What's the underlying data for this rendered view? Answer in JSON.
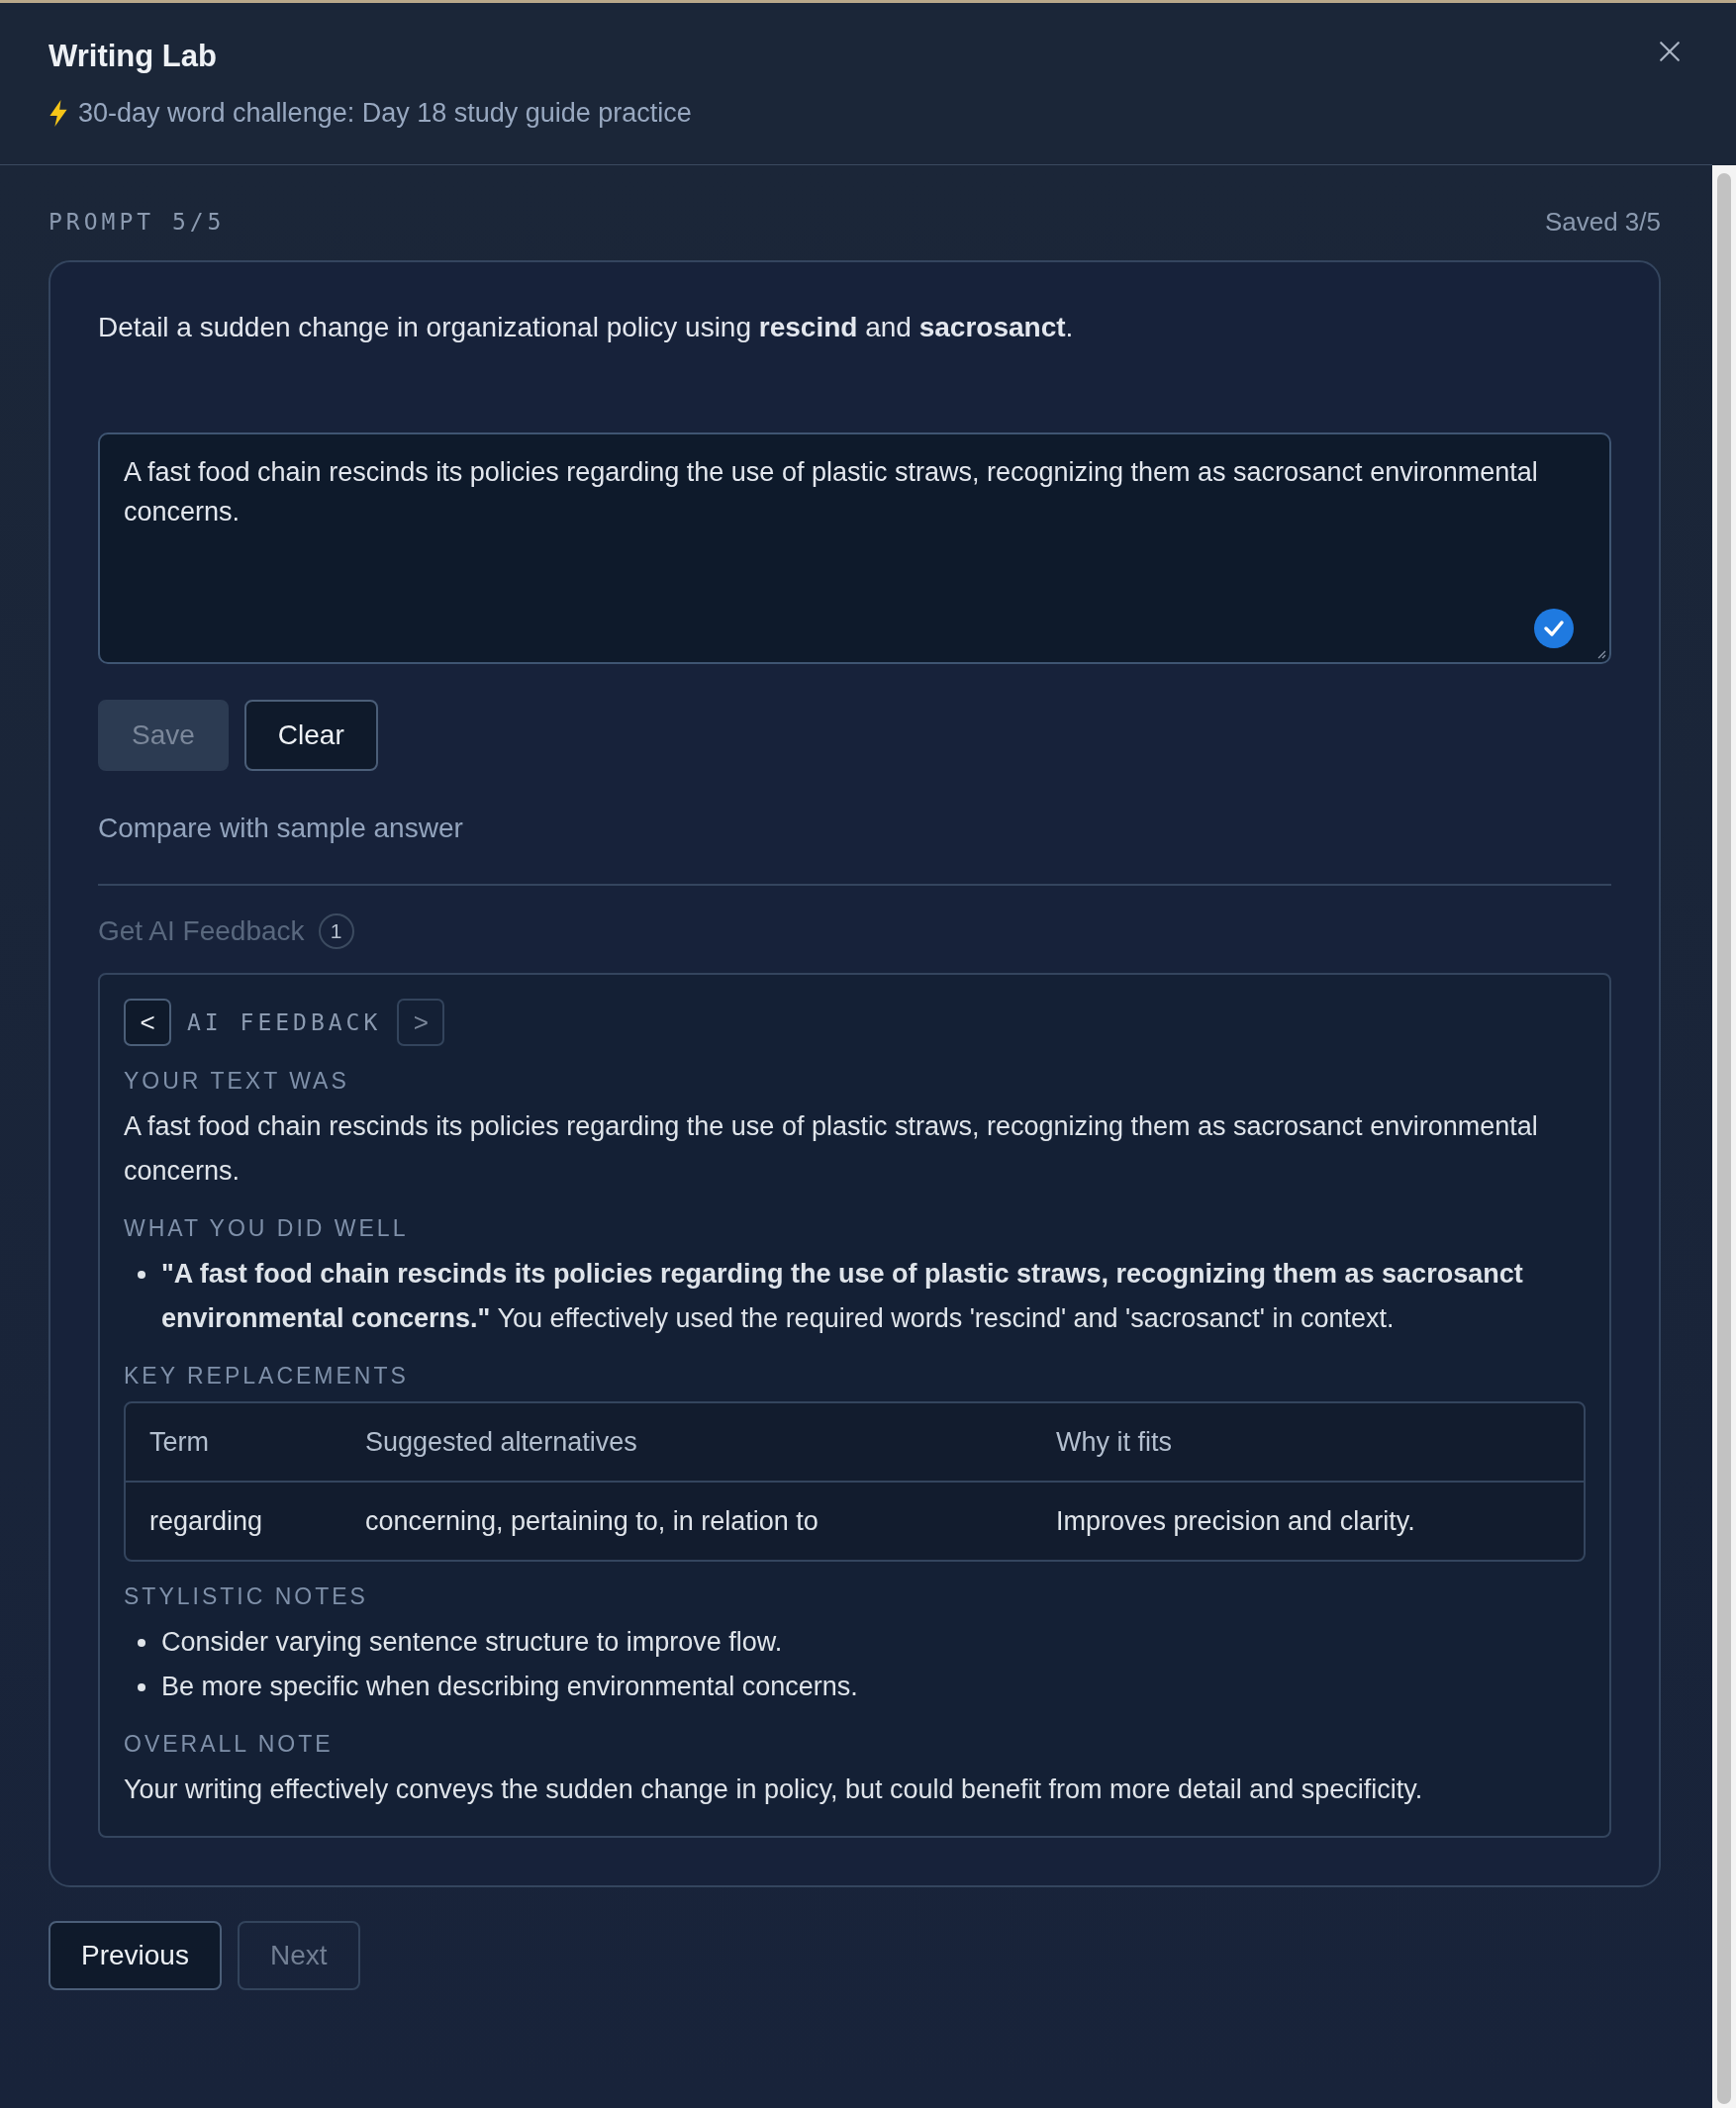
{
  "header": {
    "title": "Writing Lab",
    "subtitle": "30-day word challenge: Day 18 study guide practice"
  },
  "prompt": {
    "counter": "PROMPT 5/5",
    "saved": "Saved 3/5",
    "text": "Detail a sudden change in organizational policy using **rescind** and **sacrosanct**."
  },
  "answer": {
    "value": "A fast food chain rescinds its policies regarding the use of plastic straws, recognizing them as sacrosanct environmental concerns.",
    "valid": true
  },
  "actions": [
    {
      "label": "Save",
      "disabled": true
    },
    {
      "label": "Clear",
      "disabled": false
    }
  ],
  "compare_link": "Compare with sample answer",
  "feedback_button": {
    "label": "Get AI Feedback",
    "disabled": true,
    "count": "1"
  },
  "feedback": {
    "prev": {
      "label": "<",
      "disabled": false
    },
    "title": "AI FEEDBACK",
    "next": {
      "label": ">",
      "disabled": true
    },
    "sections": [
      {
        "kind": "text",
        "heading": "YOUR TEXT WAS",
        "text": "A fast food chain rescinds its policies regarding the use of plastic straws, recognizing them as sacrosanct environmental concerns."
      },
      {
        "kind": "bullets",
        "heading": "WHAT YOU DID WELL",
        "items": [
          "**\"A fast food chain rescinds its policies regarding the use of plastic straws, recognizing them as sacrosanct environmental concerns.\"** You effectively used the required words 'rescind' and 'sacrosanct' in context."
        ]
      },
      {
        "kind": "table",
        "heading": "KEY REPLACEMENTS",
        "columns": [
          "Term",
          "Suggested alternatives",
          "Why it fits"
        ],
        "rows": [
          [
            "regarding",
            "concerning, pertaining to, in relation to",
            "Improves precision and clarity."
          ]
        ]
      },
      {
        "kind": "bullets",
        "heading": "STYLISTIC NOTES",
        "items": [
          "Consider varying sentence structure to improve flow.",
          "Be more specific when describing environmental concerns."
        ]
      },
      {
        "kind": "text",
        "heading": "OVERALL NOTE",
        "text": "Your writing effectively conveys the sudden change in policy, but could benefit from more detail and specificity."
      }
    ]
  },
  "footer": [
    {
      "label": "Previous",
      "disabled": false
    },
    {
      "label": "Next",
      "disabled": true
    }
  ]
}
